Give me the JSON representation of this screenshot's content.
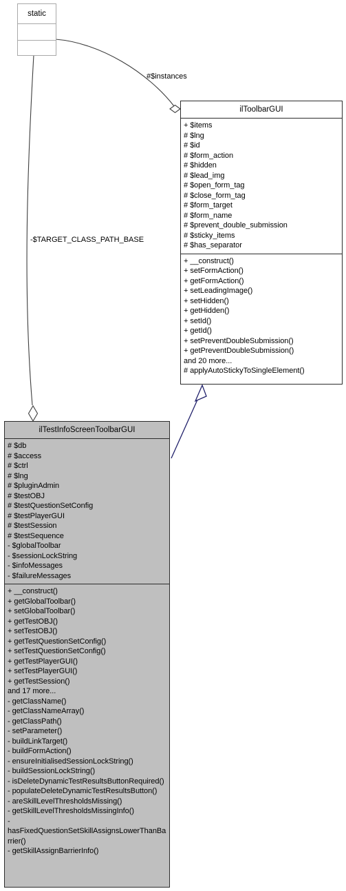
{
  "diagram": {
    "kind": "uml-class-diagram",
    "title": "ilTestInfoScreenToolbarGUI class inheritance and collaboration diagram",
    "colors": {
      "node_border": "#2b2b2b",
      "node_fill": "#ffffff",
      "focus_node_fill": "#bfbfbf",
      "stub_border": "#a8a8a8",
      "inheritance_edge": "#21216b",
      "association_edge": "#3d3d3d",
      "text": "#000000"
    }
  },
  "nodes": {
    "static_stub": {
      "name": "static_stub",
      "title": "static",
      "compartments": [
        [],
        []
      ]
    },
    "toolbar_gui": {
      "name": "ilToolbarGUI",
      "title": "ilToolbarGUI",
      "attributes": [
        "+ $items",
        "# $lng",
        "# $id",
        "# $form_action",
        "# $hidden",
        "# $lead_img",
        "# $open_form_tag",
        "# $close_form_tag",
        "# $form_target",
        "# $form_name",
        "# $prevent_double_submission",
        "# $sticky_items",
        "# $has_separator"
      ],
      "methods": [
        "+ __construct()",
        "+ setFormAction()",
        "+ getFormAction()",
        "+ setLeadingImage()",
        "+ setHidden()",
        "+ getHidden()",
        "+ setId()",
        "+ getId()",
        "+ setPreventDoubleSubmission()",
        "+ getPreventDoubleSubmission()",
        "and 20 more...",
        "# applyAutoStickyToSingleElement()"
      ]
    },
    "info_screen_toolbar_gui": {
      "name": "ilTestInfoScreenToolbarGUI",
      "title": "ilTestInfoScreenToolbarGUI",
      "attributes": [
        "# $db",
        "# $access",
        "# $ctrl",
        "# $lng",
        "# $pluginAdmin",
        "# $testOBJ",
        "# $testQuestionSetConfig",
        "# $testPlayerGUI",
        "# $testSession",
        "# $testSequence",
        "- $globalToolbar",
        "- $sessionLockString",
        "- $infoMessages",
        "- $failureMessages"
      ],
      "methods": [
        "+ __construct()",
        "+ getGlobalToolbar()",
        "+ setGlobalToolbar()",
        "+ getTestOBJ()",
        "+ setTestOBJ()",
        "+ getTestQuestionSetConfig()",
        "+ setTestQuestionSetConfig()",
        "+ getTestPlayerGUI()",
        "+ setTestPlayerGUI()",
        "+ getTestSession()",
        "and 17 more...",
        "- getClassName()",
        "- getClassNameArray()",
        "- getClassPath()",
        "- setParameter()",
        "- buildLinkTarget()",
        "- buildFormAction()",
        "- ensureInitialisedSessionLockString()",
        "- buildSessionLockString()",
        "- isDeleteDynamicTestResultsButtonRequired()",
        "- populateDeleteDynamicTestResultsButton()",
        "- areSkillLevelThresholdsMissing()",
        "- getSkillLevelThresholdsMissingInfo()",
        "- hasFixedQuestionSetSkillAssignsLowerThanBarrier()",
        "- getSkillAssignBarrierInfo()"
      ]
    }
  },
  "edges": {
    "instances": {
      "label": "#$instances",
      "type": "aggregation",
      "from": "static_stub",
      "to": "ilToolbarGUI"
    },
    "target_class_path_base": {
      "label": "-$TARGET_CLASS_PATH_BASE",
      "type": "aggregation",
      "from": "static_stub",
      "to": "ilTestInfoScreenToolbarGUI"
    },
    "inheritance": {
      "label": "",
      "type": "generalization",
      "from": "ilTestInfoScreenToolbarGUI",
      "to": "ilToolbarGUI"
    }
  }
}
